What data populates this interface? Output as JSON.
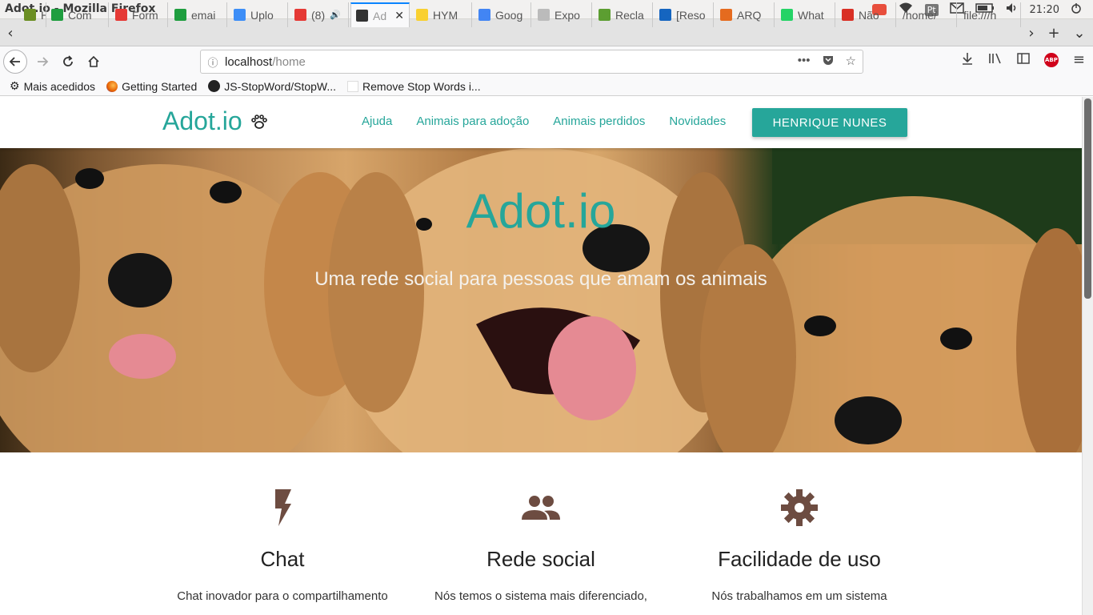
{
  "os": {
    "window_title": "Adot.io - Mozilla Firefox",
    "lang": "Pt",
    "clock": "21:20"
  },
  "tabs": [
    {
      "label": "HP",
      "fav": "#6b8e23"
    },
    {
      "label": "Com",
      "fav": "#1f9e3f"
    },
    {
      "label": "Form",
      "fav": "#e53935"
    },
    {
      "label": "emai",
      "fav": "#1f9e3f"
    },
    {
      "label": "Uplo",
      "fav": "#3d8ef7"
    },
    {
      "label": "(8)",
      "fav": "#e53935"
    },
    {
      "label": "Ad",
      "fav": "#333333"
    },
    {
      "label": "HYM",
      "fav": "#f9d030"
    },
    {
      "label": "Goog",
      "fav": "#4285f4"
    },
    {
      "label": "Expo",
      "fav": "#bbbbbb"
    },
    {
      "label": "Recla",
      "fav": "#5c9e31"
    },
    {
      "label": "[Reso",
      "fav": "#1565c0"
    },
    {
      "label": "ARQ",
      "fav": "#e56b1f"
    },
    {
      "label": "What",
      "fav": "#25d366"
    },
    {
      "label": "Não",
      "fav": "#d93025"
    },
    {
      "label": "/home/",
      "fav": ""
    },
    {
      "label": "file:///h",
      "fav": ""
    }
  ],
  "url": {
    "host": "localhost",
    "path": "/home"
  },
  "bookmarks": [
    {
      "label": "Mais acedidos"
    },
    {
      "label": "Getting Started"
    },
    {
      "label": "JS-StopWord/StopW..."
    },
    {
      "label": "Remove Stop Words i..."
    }
  ],
  "site": {
    "brand": "Adot.io",
    "nav": [
      "Ajuda",
      "Animais para adoção",
      "Animais perdidos",
      "Novidades"
    ],
    "user_button": "HENRIQUE NUNES",
    "hero_title": "Adot.io",
    "hero_subtitle": "Uma rede social para pessoas que amam os animais",
    "features": [
      {
        "icon": "flash-icon",
        "title": "Chat",
        "text": "Chat inovador para o compartilhamento"
      },
      {
        "icon": "people-icon",
        "title": "Rede social",
        "text": "Nós temos o sistema mais diferenciado,"
      },
      {
        "icon": "settings-icon",
        "title": "Facilidade de uso",
        "text": "Nós trabalhamos em um sistema"
      }
    ]
  },
  "colors": {
    "accent": "#26a69a",
    "feature_icon": "#6d4c41"
  }
}
